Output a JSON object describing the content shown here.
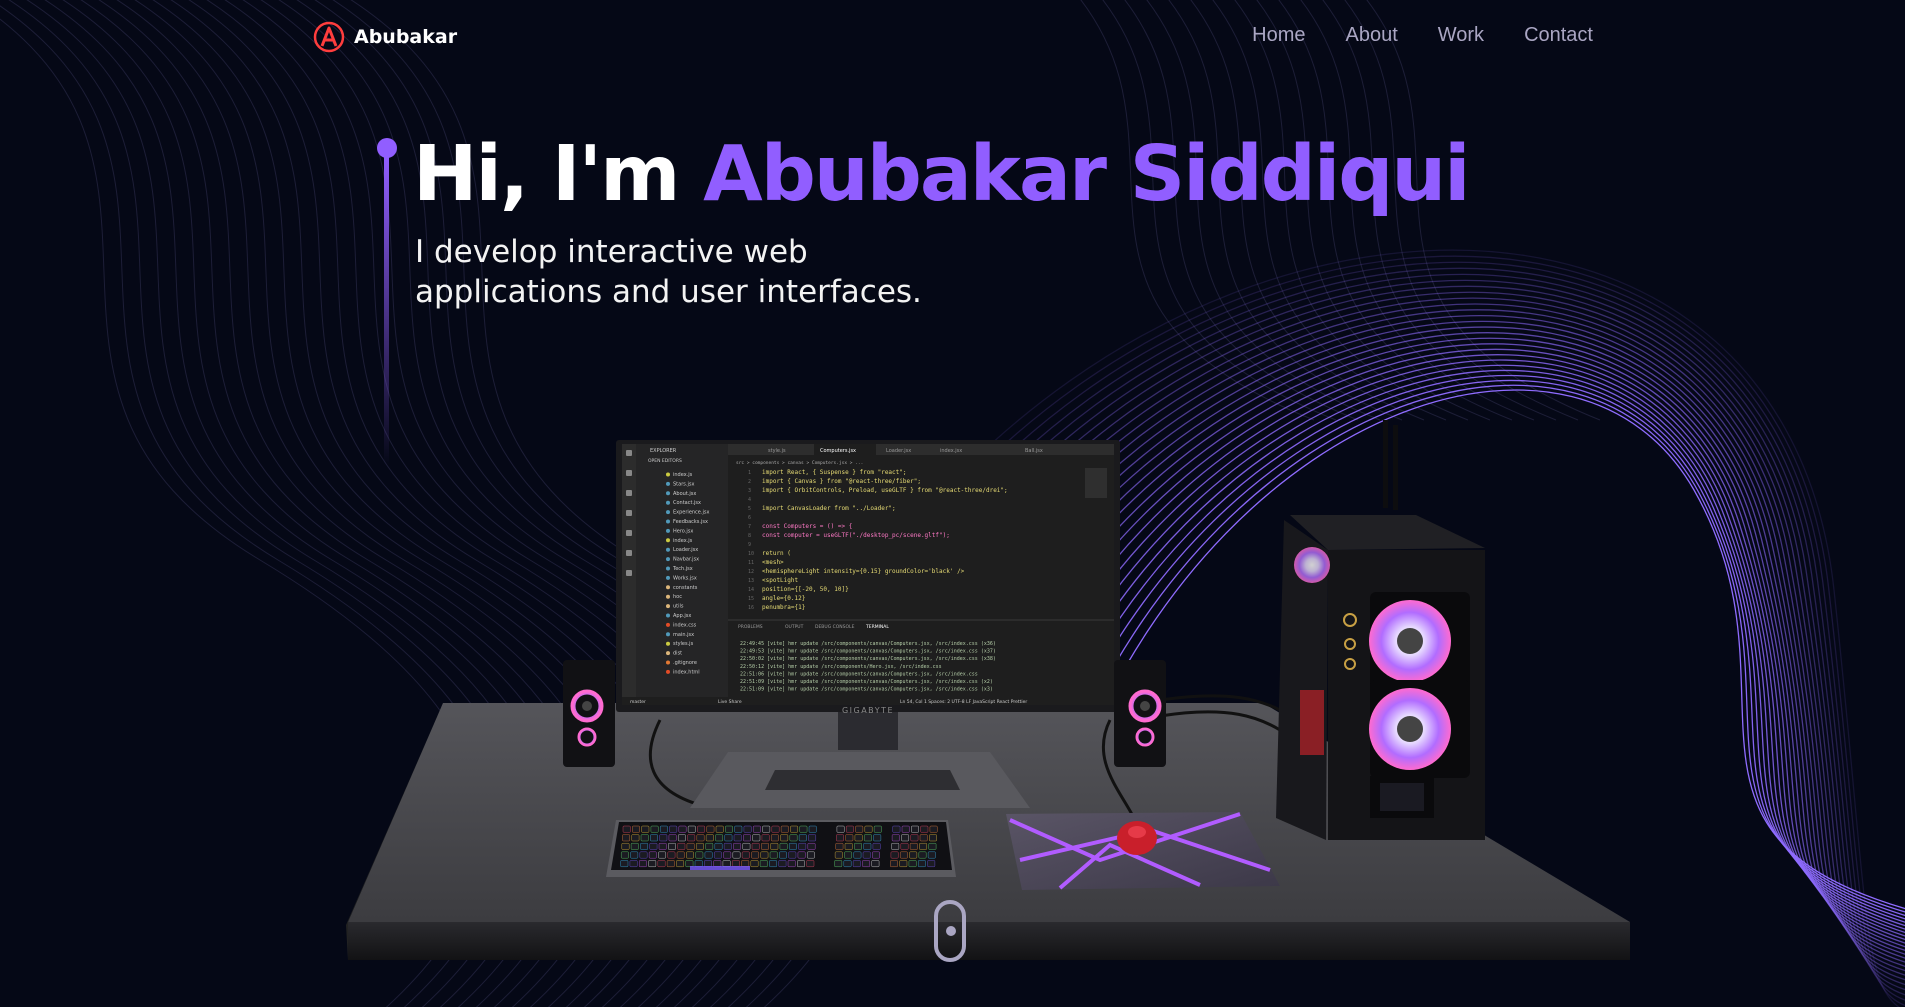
{
  "nav": {
    "logo_letter": "A",
    "brand": "Abubakar",
    "links": [
      "Home",
      "About",
      "Work",
      "Contact"
    ]
  },
  "hero": {
    "greeting": "Hi, I'm ",
    "name": "Abubakar Siddiqui",
    "subtitle_line1": "I develop interactive web",
    "subtitle_line2": "applications and user interfaces."
  },
  "monitor": {
    "brand": "GIGABYTE",
    "explorer_title": "EXPLORER",
    "open_editors": "OPEN EDITORS",
    "tabs": [
      "style.js",
      "Computers.jsx",
      "Loader.jsx",
      "index.jsx",
      "Ball.jsx"
    ],
    "breadcrumb": "src > components > canvas > Computers.jsx > ...",
    "files": [
      "index.js",
      "Stars.jsx",
      "About.jsx",
      "Contact.jsx",
      "Experience.jsx",
      "Feedbacks.jsx",
      "Hero.jsx",
      "index.js",
      "Loader.jsx",
      "Navbar.jsx",
      "Tech.jsx",
      "Works.jsx",
      "constants",
      "hoc",
      "utils",
      "App.jsx",
      "index.css",
      "main.jsx",
      "styles.js",
      "dist",
      ".gitignore",
      "index.html"
    ],
    "code_lines": [
      "import React, { Suspense } from \"react\";",
      "import { Canvas } from \"@react-three/fiber\";",
      "import { OrbitControls, Preload, useGLTF } from \"@react-three/drei\";",
      "",
      "import CanvasLoader from \"../Loader\";",
      "",
      "const Computers = () => {",
      "  const computer = useGLTF(\"./desktop_pc/scene.gltf\");",
      "",
      "  return (",
      "    <mesh>",
      "      <hemisphereLight intensity={0.15} groundColor='black' />",
      "      <spotLight",
      "        position={[-20, 50, 10]}",
      "        angle={0.12}",
      "        penumbra={1}"
    ],
    "panel_tabs": [
      "PROBLEMS",
      "OUTPUT",
      "DEBUG CONSOLE",
      "TERMINAL"
    ],
    "terminal_lines": [
      "22:49:45 [vite] hmr update /src/components/canvas/Computers.jsx, /src/index.css (x36)",
      "22:49:53 [vite] hmr update /src/components/canvas/Computers.jsx, /src/index.css (x37)",
      "22:50:02 [vite] hmr update /src/components/canvas/Computers.jsx, /src/index.css (x38)",
      "22:50:12 [vite] hmr update /src/components/Hero.jsx, /src/index.css",
      "22:51:06 [vite] hmr update /src/components/canvas/Computers.jsx, /src/index.css",
      "22:51:09 [vite] hmr update /src/components/canvas/Computers.jsx, /src/index.css (x2)",
      "22:51:09 [vite] hmr update /src/components/canvas/Computers.jsx, /src/index.css (x3)"
    ],
    "status_left": "master",
    "status_live": "Live Share",
    "status_right": "Ln 54, Col 1   Spaces: 2   UTF-8   LF   JavaScript React   Prettier"
  },
  "colors": {
    "background": "#050816",
    "accent": "#915eff",
    "secondary_text": "#aaa6c3",
    "logo_red": "#ff3d3d"
  }
}
